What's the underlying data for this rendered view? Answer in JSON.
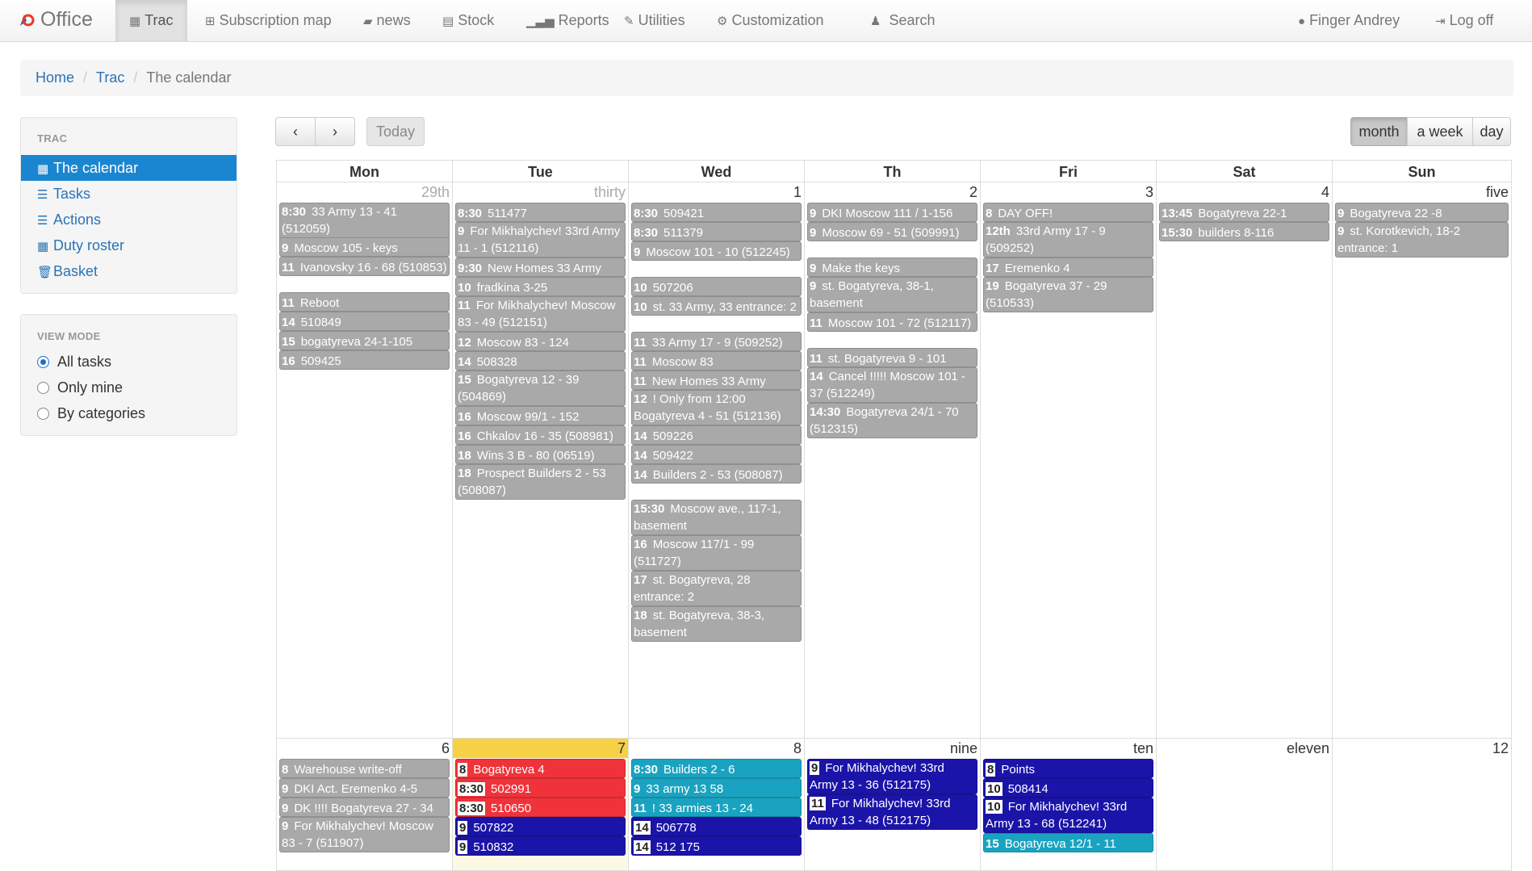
{
  "nav": {
    "brand": "Office",
    "items": [
      {
        "label": "Trac",
        "icon": "calendar-icon"
      },
      {
        "label": "Subscription map",
        "icon": "sitemap-icon"
      },
      {
        "label": "news",
        "icon": "book-icon"
      },
      {
        "label": "Stock",
        "icon": "inbox-icon"
      },
      {
        "label": "Reports",
        "icon": "signal-icon"
      },
      {
        "label": "Utilities",
        "icon": "wrench-icon"
      },
      {
        "label": "Customization",
        "icon": "cogs-icon"
      },
      {
        "label": "Search",
        "icon": "user-search-icon"
      }
    ],
    "user": "Finger Andrey",
    "logoff": "Log off"
  },
  "breadcrumb": {
    "home": "Home",
    "trac": "Trac",
    "current": "The calendar"
  },
  "sidebar": {
    "title": "TRAC",
    "items": [
      "The calendar",
      "Tasks",
      "Actions",
      "Duty roster",
      "Basket"
    ]
  },
  "view_mode": {
    "title": "VIEW MODE",
    "options": [
      "All tasks",
      "Only mine",
      "By categories"
    ],
    "selected": "All tasks"
  },
  "toolbar": {
    "today": "Today",
    "month": "month",
    "week": "a week",
    "day": "day"
  },
  "calendar": {
    "headers": [
      "Mon",
      "Tue",
      "Wed",
      "Th",
      "Fri",
      "Sat",
      "Sun"
    ],
    "week1": {
      "days": [
        "29th",
        "thirty",
        "1",
        "2",
        "3",
        "4",
        "five"
      ],
      "mon": [
        {
          "t": "8:30",
          "x": "33 Army 13 - 41 (512059)"
        },
        {
          "t": "9",
          "x": "Moscow 105 - keys"
        },
        {
          "t": "11",
          "x": "Ivanovsky 16 - 68 (510853)"
        },
        {
          "t": "11",
          "x": "Reboot"
        },
        {
          "t": "14",
          "x": "510849"
        },
        {
          "t": "15",
          "x": "bogatyreva 24-1-105"
        },
        {
          "t": "16",
          "x": "509425"
        }
      ],
      "tue": [
        {
          "t": "8:30",
          "x": "511477"
        },
        {
          "t": "9",
          "x": "For Mikhalychev! 33rd Army 11 - 1 (512116)"
        },
        {
          "t": "9:30",
          "x": "New Homes 33 Army"
        },
        {
          "t": "10",
          "x": "fradkina 3-25"
        },
        {
          "t": "11",
          "x": "For Mikhalychev! Moscow 83 - 49 (512151)"
        },
        {
          "t": "12",
          "x": "Moscow 83 - 124"
        },
        {
          "t": "14",
          "x": "508328"
        },
        {
          "t": "15",
          "x": "Bogatyreva 12 - 39 (504869)"
        },
        {
          "t": "16",
          "x": "Moscow 99/1 - 152"
        },
        {
          "t": "16",
          "x": "Chkalov 16 - 35 (508981)"
        },
        {
          "t": "18",
          "x": "Wins 3 B - 80 (06519)"
        },
        {
          "t": "18",
          "x": "Prospect Builders 2 - 53 (508087)"
        }
      ],
      "wed": [
        {
          "t": "8:30",
          "x": "509421"
        },
        {
          "t": "8:30",
          "x": "511379"
        },
        {
          "t": "9",
          "x": "Moscow 101 - 10 (512245)"
        },
        {
          "t": "10",
          "x": "507206"
        },
        {
          "t": "10",
          "x": "st. 33 Army, 33 entrance: 2"
        },
        {
          "t": "11",
          "x": "33 Army 17 - 9 (509252)"
        },
        {
          "t": "11",
          "x": "Moscow 83"
        },
        {
          "t": "11",
          "x": "New Homes 33 Army"
        },
        {
          "t": "12",
          "x": "! Only from 12:00 Bogatyreva 4 - 51 (512136)"
        },
        {
          "t": "14",
          "x": "509226"
        },
        {
          "t": "14",
          "x": "509422"
        },
        {
          "t": "14",
          "x": "Builders 2 - 53 (508087)"
        },
        {
          "t": "15:30",
          "x": "Moscow ave., 117-1, basement"
        },
        {
          "t": "16",
          "x": "Moscow 117/1 - 99 (511727)"
        },
        {
          "t": "17",
          "x": "st. Bogatyreva, 28 entrance: 2"
        },
        {
          "t": "18",
          "x": "st. Bogatyreva, 38-3, basement"
        }
      ],
      "thu": [
        {
          "t": "9",
          "x": "DKI Moscow 111 / 1-156"
        },
        {
          "t": "9",
          "x": "Moscow 69 - 51 (509991)"
        },
        {
          "t": "9",
          "x": "Make the keys"
        },
        {
          "t": "9",
          "x": "st. Bogatyreva, 38-1, basement"
        },
        {
          "t": "11",
          "x": "Moscow 101 - 72 (512117)"
        },
        {
          "t": "11",
          "x": "st. Bogatyreva 9 - 101"
        },
        {
          "t": "14",
          "x": "Cancel !!!!! Moscow 101 - 37 (512249)"
        },
        {
          "t": "14:30",
          "x": "Bogatyreva 24/1 - 70 (512315)"
        }
      ],
      "fri": [
        {
          "t": "8",
          "x": "DAY OFF!"
        },
        {
          "t": "12th",
          "x": "33rd Army 17 - 9 (509252)"
        },
        {
          "t": "17",
          "x": "Eremenko 4"
        },
        {
          "t": "19",
          "x": "Bogatyreva 37 - 29 (510533)"
        }
      ],
      "sat": [
        {
          "t": "13:45",
          "x": "Bogatyreva 22-1"
        },
        {
          "t": "15:30",
          "x": "builders 8-116"
        }
      ],
      "sun": [
        {
          "t": "9",
          "x": "Bogatyreva 22 -8"
        },
        {
          "t": "9",
          "x": "st. Korotkevich, 18-2 entrance: 1"
        }
      ]
    },
    "week2": {
      "days": [
        "6",
        "7",
        "8",
        "nine",
        "ten",
        "eleven",
        "12"
      ],
      "mon": [
        {
          "t": "8",
          "x": "Warehouse write-off"
        },
        {
          "t": "9",
          "x": "DKI Act. Eremenko 4-5"
        },
        {
          "t": "9",
          "x": "DK !!!! Bogatyreva 27 - 34"
        },
        {
          "t": "9",
          "x": "For Mikhalychev! Moscow 83 - 7 (511907)"
        }
      ],
      "tue": [
        {
          "t": "8",
          "x": "Bogatyreva 4"
        },
        {
          "t": "8:30",
          "x": "502991"
        },
        {
          "t": "8:30",
          "x": "510650"
        },
        {
          "t": "9",
          "x": "507822"
        },
        {
          "t": "9",
          "x": "510832"
        }
      ],
      "wed": [
        {
          "t": "8:30",
          "x": "Builders 2 - 6"
        },
        {
          "t": "9",
          "x": "33 army 13 58"
        },
        {
          "t": "11",
          "x": "! 33 armies 13 - 24"
        },
        {
          "t": "14",
          "x": "506778"
        },
        {
          "t": "14",
          "x": "512 175"
        }
      ],
      "thu": [
        {
          "t": "9",
          "x": "For Mikhalychev! 33rd Army 13 - 36 (512175)"
        },
        {
          "t": "11",
          "x": "For Mikhalychev! 33rd Army 13 - 48 (512175)"
        }
      ],
      "fri": [
        {
          "t": "8",
          "x": "Points"
        },
        {
          "t": "10",
          "x": "508414"
        },
        {
          "t": "10",
          "x": "For Mikhalychev! 33rd Army 13 - 68 (512241)"
        },
        {
          "t": "15",
          "x": "Bogatyreva 12/1 - 11"
        }
      ]
    }
  },
  "colors": {
    "accent": "#1b86d0",
    "event_gray": "#a9a9a9",
    "event_red": "#f0333a",
    "event_teal": "#1aa3c0",
    "event_blue": "#1b14a8",
    "today": "#f7d145"
  }
}
